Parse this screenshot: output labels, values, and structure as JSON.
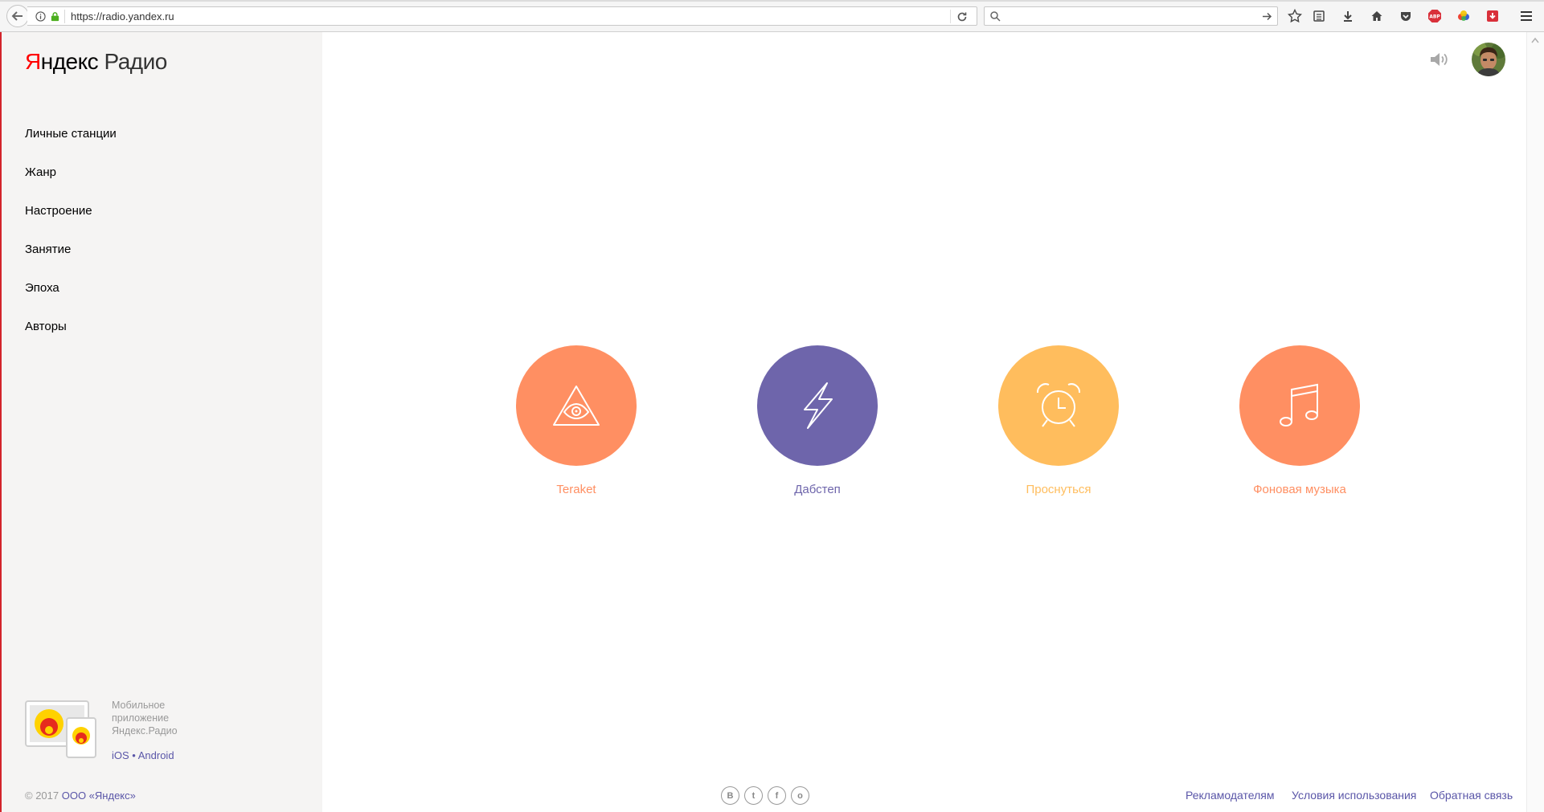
{
  "browser": {
    "url": "https://radio.yandex.ru",
    "search_placeholder": ""
  },
  "logo": {
    "ya": "Я",
    "ndex": "ндекс",
    "radio": "Радио"
  },
  "nav": {
    "items": [
      {
        "label": "Личные станции"
      },
      {
        "label": "Жанр"
      },
      {
        "label": "Настроение"
      },
      {
        "label": "Занятие"
      },
      {
        "label": "Эпоха"
      },
      {
        "label": "Авторы"
      }
    ]
  },
  "promo": {
    "line1": "Мобильное",
    "line2": "приложение",
    "line3": "Яндекс.Радио",
    "ios": "iOS",
    "sep": " • ",
    "android": "Android"
  },
  "copyright": {
    "prefix": "© 2017 ",
    "company": "ООО «Яндекс»"
  },
  "stations": [
    {
      "label": "Teraket",
      "color": "#ff8f62",
      "icon": "eye-triangle-icon"
    },
    {
      "label": "Дабстеп",
      "color": "#6e65ab",
      "icon": "lightning-icon"
    },
    {
      "label": "Проснуться",
      "color": "#ffbd5d",
      "icon": "alarm-clock-icon"
    },
    {
      "label": "Фоновая музыка",
      "color": "#ff8f62",
      "icon": "music-note-icon"
    }
  ],
  "social": {
    "vk": "В",
    "twitter": "t",
    "facebook": "f",
    "ok": "о"
  },
  "footer": {
    "ads": "Рекламодателям",
    "terms": "Условия использования",
    "feedback": "Обратная связь"
  },
  "colors": {
    "accent_link": "#5a56a8",
    "sidebar_bg": "#f5f4f3",
    "brand_red": "#ff0000"
  }
}
